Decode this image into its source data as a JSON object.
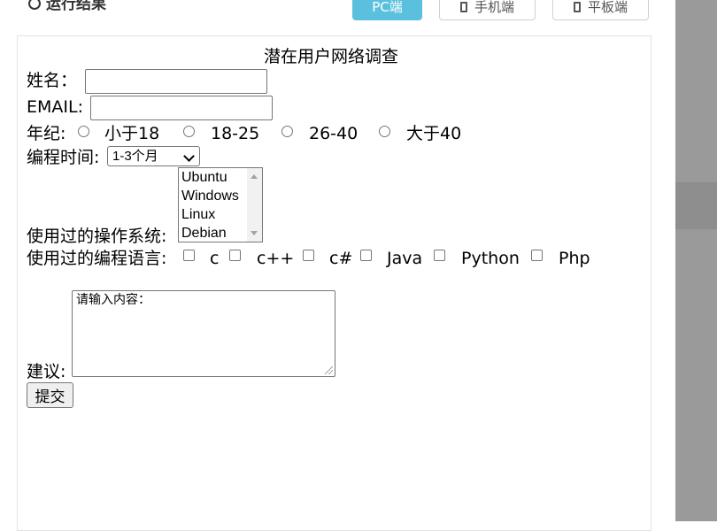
{
  "header": {
    "title": "运行结果",
    "buttons": {
      "pc": "PC端",
      "mobile": "手机端",
      "tablet": "平板端"
    }
  },
  "form": {
    "title": "潜在用户网络调查",
    "name_label": "姓名：",
    "email_label": "EMAIL:",
    "age_label": "年纪:",
    "age_options": [
      "小于18",
      "18-25",
      "26-40",
      "大于40"
    ],
    "time_label": "编程时间:",
    "time_selected": "1-3个月",
    "os_label": "使用过的操作系统:",
    "os_options": [
      "Ubuntu",
      "Windows",
      "Linux",
      "Debian"
    ],
    "lang_label": "使用过的编程语言:",
    "lang_options": [
      "c",
      "c++",
      "c#",
      "Java",
      "Python",
      "Php"
    ],
    "suggest_label": "建议:",
    "suggest_text": "请输入内容：",
    "submit_label": "提交"
  },
  "colors": {
    "active_button": "#5bc0de",
    "side_panel": "#9a9a9a"
  }
}
